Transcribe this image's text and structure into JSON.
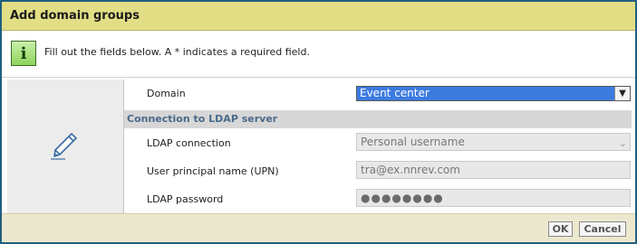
{
  "dialog": {
    "title": "Add domain groups",
    "info_icon": "info-icon",
    "info_text": "Fill out the fields below. A * indicates a required field.",
    "side_icon": "pencil-icon"
  },
  "form": {
    "domain_label": "Domain",
    "domain_value": "Event center",
    "section_title": "Connection to LDAP server",
    "ldap_connection_label": "LDAP connection",
    "ldap_connection_value": "Personal username",
    "upn_label": "User principal name (UPN)",
    "upn_value": "tra@ex.nnrev.com",
    "password_label": "LDAP password",
    "password_value": "●●●●●●●●"
  },
  "footer": {
    "ok_label": "OK",
    "cancel_label": "Cancel"
  },
  "colors": {
    "title_bar": "#e2de85",
    "footer": "#ece8cf",
    "selected_field": "#3b7be0",
    "section_header_text": "#4a6a8a"
  }
}
